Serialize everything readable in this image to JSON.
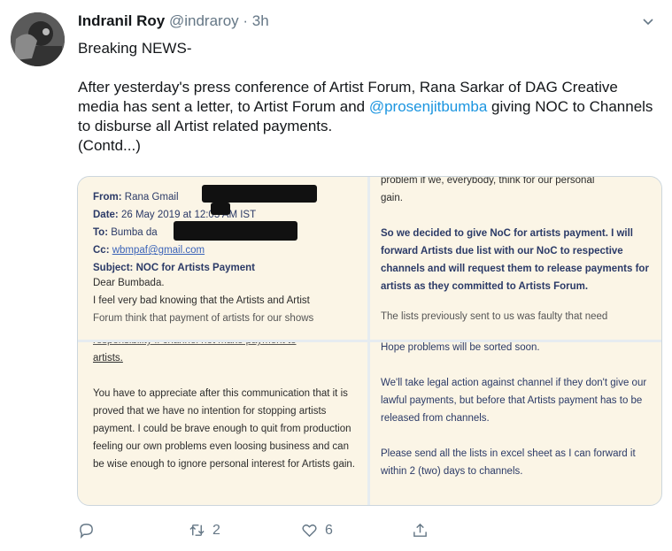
{
  "tweet": {
    "author_name": "Indranil Roy",
    "handle": "@indraroy",
    "separator": "·",
    "time": "3h",
    "line1": "Breaking NEWS-",
    "para_part1": "After yesterday's press conference of Artist Forum, Rana Sarkar of DAG Creative media has sent a letter, to Artist Forum and ",
    "mention": "@prosenjitbumba",
    "para_part2": " giving NOC to Channels to disburse all Artist related payments.",
    "contd": "(Contd...)"
  },
  "media": {
    "email": {
      "from_label": "From:",
      "from_value": "Rana Gmail",
      "date_label": "Date:",
      "date_value": "26 May 2019 at 12:03 AM IST",
      "to_label": "To:",
      "to_value": "Bumba da",
      "cc_label": "Cc:",
      "cc_value": "wbmpaf@gmail.com",
      "subject_label": "Subject:",
      "subject_value": "NOC for Artists Payment",
      "greeting": "Dear Bumbada.",
      "body1": "I feel very bad knowing that the Artists and Artist",
      "body1_cut": "Forum think that payment of artists for our shows"
    },
    "panel2": {
      "line_top": "problem if we, everybody, think for our personal",
      "line_top2": "gain.",
      "para": "So we decided to give NoC for artists payment. I will forward Artists due list with our NoC to respective channels and will request them to release payments for artists as they committed to Artists Forum.",
      "cut": "The lists previously sent to us was faulty that need"
    },
    "panel3": {
      "top_cut": "responsibility if channel not make payment to",
      "top2": "artists.",
      "para": "You have to appreciate after this communication that it is proved that we have no intention for stopping artists payment. I could be brave enough to quit from production feeling our own problems even loosing business and can be wise enough to ignore personal interest for Artists gain."
    },
    "panel4": {
      "p1": "Hope problems will be sorted soon.",
      "p2": "We'll take legal action against channel if they don't give our lawful payments, but before that Artists payment has to be released from channels.",
      "p3": "Please send all the lists in excel sheet as I can forward it within 2 (two) days to channels."
    }
  },
  "actions": {
    "retweets": "2",
    "likes": "6"
  },
  "icons": {
    "reply": "reply-icon",
    "retweet": "retweet-icon",
    "like": "heart-icon",
    "share": "share-icon",
    "caret": "chevron-down-icon"
  },
  "colors": {
    "accent": "#1b95e0",
    "muted": "#657786",
    "paper": "#fbf5e6"
  }
}
